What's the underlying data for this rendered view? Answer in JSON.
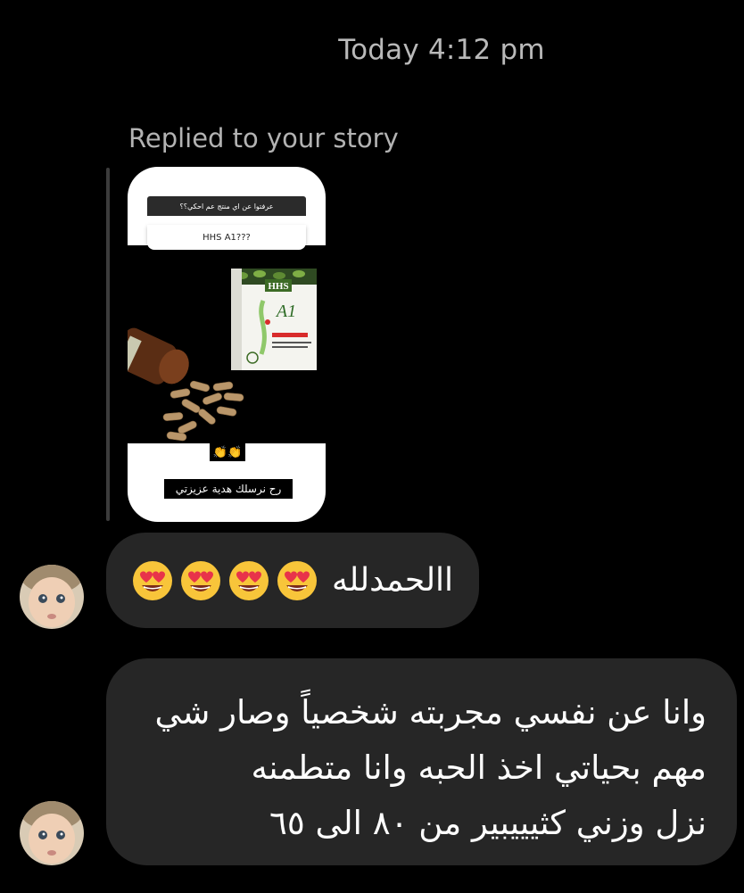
{
  "thread": {
    "timestamp": "Today 4:12 pm",
    "reply_label": "Replied to your story"
  },
  "story": {
    "question": "عرفتوا عن اي منتج عم احكي؟؟",
    "answer": "HHS A1???",
    "product_brand": "HHS",
    "product_name": "A1",
    "hands_emoji": "👏👏",
    "caption": "رح نرسلك هدية عزيزتي"
  },
  "messages": [
    {
      "text": "االحمدلله",
      "emoji_icon": "heart-eyes-emoji",
      "emoji_count": 4,
      "emoji": "😍😍😍😍"
    },
    {
      "lines": [
        "وانا عن نفسي مجربته شخصياً وصار شي",
        "مهم بحياتي اخذ الحبه وانا متطمنه",
        "نزل وزني كثيييبير من ٨٠ الى ٦٥"
      ]
    }
  ],
  "colors": {
    "background": "#000000",
    "bubble": "#262626",
    "muted_text": "#b9b9b9",
    "emoji_face": "#f8c53a",
    "heart": "#e8334a"
  }
}
